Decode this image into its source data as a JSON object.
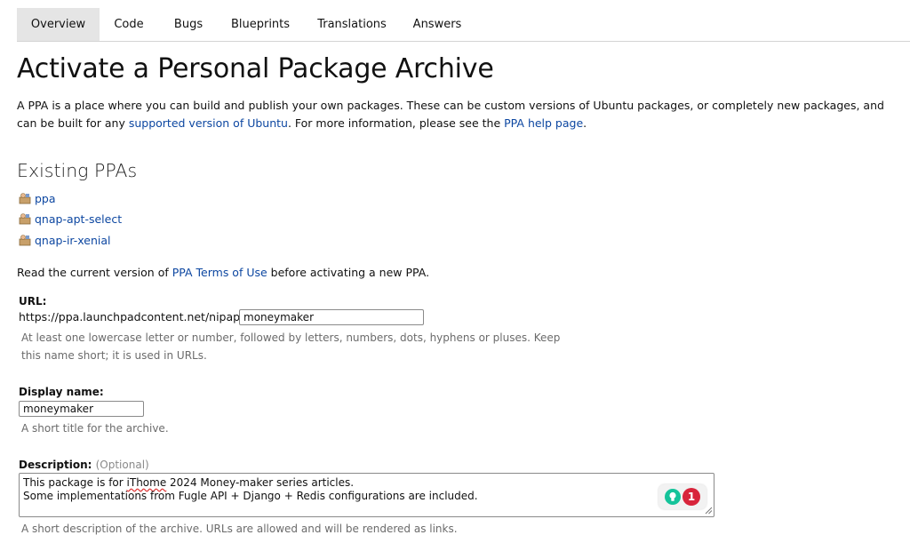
{
  "tabs": [
    {
      "label": "Overview",
      "active": true
    },
    {
      "label": "Code",
      "active": false
    },
    {
      "label": "Bugs",
      "active": false
    },
    {
      "label": "Blueprints",
      "active": false
    },
    {
      "label": "Translations",
      "active": false
    },
    {
      "label": "Answers",
      "active": false
    }
  ],
  "page": {
    "title": "Activate a Personal Package Archive",
    "intro_1": "A PPA is a place where you can build and publish your own packages. These can be custom versions of Ubuntu packages, or completely new packages, and can be built for any ",
    "intro_link_1": "supported version of Ubuntu",
    "intro_2": ". For more information, please see the ",
    "intro_link_2": "PPA help page",
    "intro_3": "."
  },
  "existing": {
    "heading": "Existing PPAs",
    "items": [
      {
        "name": "ppa"
      },
      {
        "name": "qnap-apt-select"
      },
      {
        "name": "qnap-ir-xenial"
      }
    ]
  },
  "terms": {
    "before": "Read the current version of ",
    "link": "PPA Terms of Use",
    "after": " before activating a new PPA."
  },
  "form": {
    "url": {
      "label": "URL:",
      "prefix": "https://ppa.launchpadcontent.net/nipapa/",
      "value": "moneymaker",
      "hint_1": "At least one lowercase letter or number, followed by letters, numbers, dots, hyphens or pluses. Keep",
      "hint_2": "this name short; it is used in URLs."
    },
    "display_name": {
      "label": "Display name:",
      "value": "moneymaker",
      "hint": "A short title for the archive."
    },
    "description": {
      "label": "Description:",
      "optional": "(Optional)",
      "line1_pre": "This package is for ",
      "line1_flagged": "iThome",
      "line1_post": " 2024 Money-maker series articles.",
      "line2": "Some implementations from Fugle API + Django + Redis configurations are included.",
      "hint": "A short description of the archive. URLs are allowed and will be rendered as links."
    }
  },
  "grammar_widget": {
    "count": "1",
    "icon": "lightbulb-icon",
    "color_ok": "#15c39a",
    "color_alert": "#d8243b"
  }
}
